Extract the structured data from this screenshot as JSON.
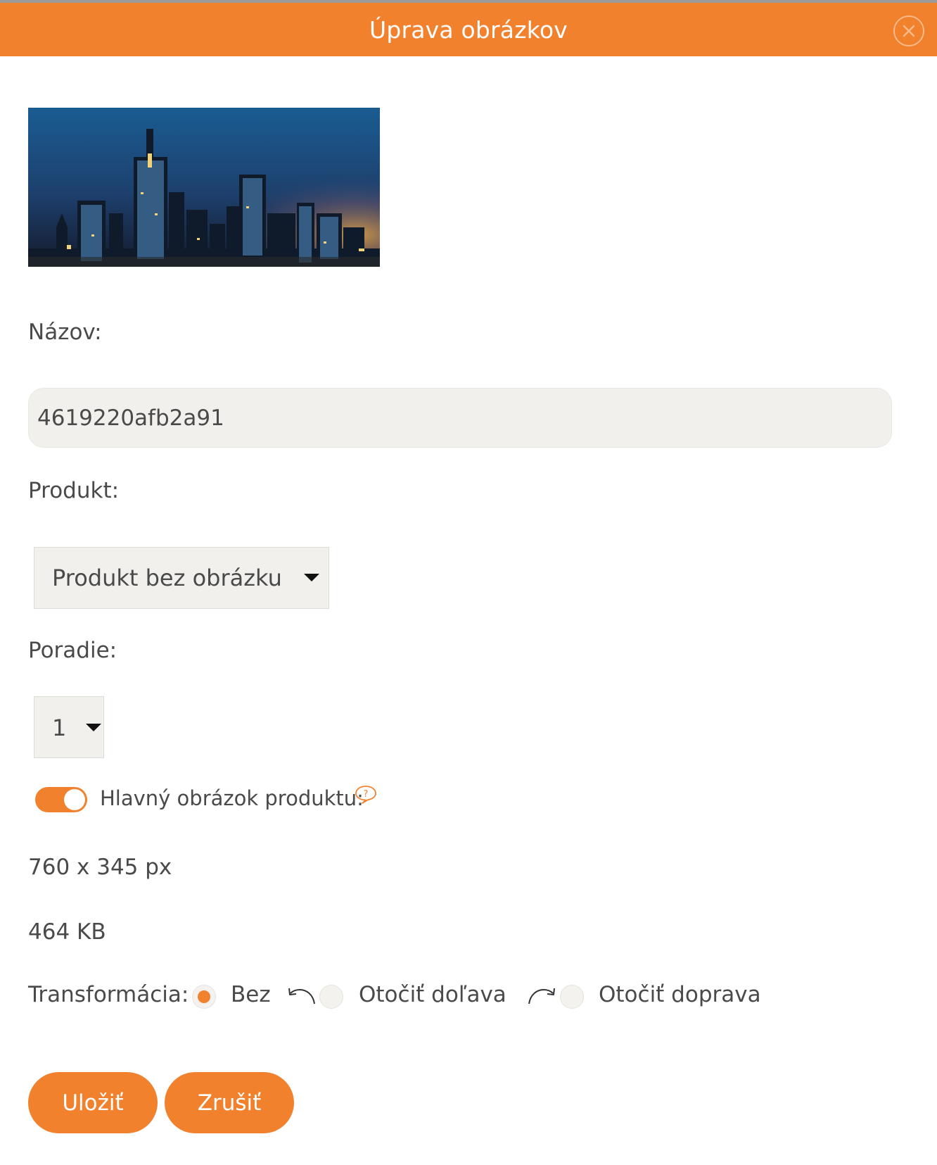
{
  "dialog": {
    "title": "Úprava obrázkov"
  },
  "form": {
    "name_label": "Názov:",
    "name_value": "4619220afb2a91",
    "product_label": "Produkt:",
    "product_value": "Produkt bez obrázku",
    "order_label": "Poradie:",
    "order_value": "1",
    "main_image_label": "Hlavný obrázok produktu:",
    "main_image_on": true
  },
  "image_info": {
    "dimensions": "760 x 345 px",
    "size": "464 KB"
  },
  "transform": {
    "label": "Transformácia:",
    "options": [
      {
        "label": "Bez",
        "checked": true,
        "icon": ""
      },
      {
        "label": "Otočiť doľava",
        "checked": false,
        "icon": "rotate-left-icon"
      },
      {
        "label": "Otočiť doprava",
        "checked": false,
        "icon": "rotate-right-icon"
      }
    ]
  },
  "actions": {
    "save_label": "Uložiť",
    "cancel_label": "Zrušiť"
  },
  "colors": {
    "accent": "#f2812e",
    "field_bg": "#f1f0ec"
  }
}
